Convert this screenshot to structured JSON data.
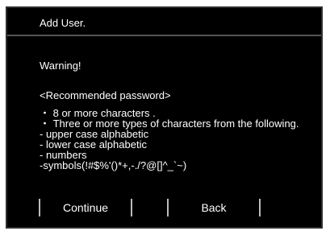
{
  "dialog": {
    "title": "Add User.",
    "warning": "Warning!",
    "recommended_heading": "<Recommended password>",
    "requirements": [
      "・ 8 or more characters .",
      "・ Three or more types of characters from the following.",
      "- upper case alphabetic",
      "- lower case alphabetic",
      "- numbers",
      "-symbols(!#$%'()*+,-./?@[]^_`~)"
    ],
    "buttons": {
      "continue_label": "Continue",
      "back_label": "Back"
    }
  },
  "colors": {
    "background": "#000000",
    "text": "#ffffff",
    "divider": "#555555",
    "button_edge": "#bbbbbb"
  }
}
